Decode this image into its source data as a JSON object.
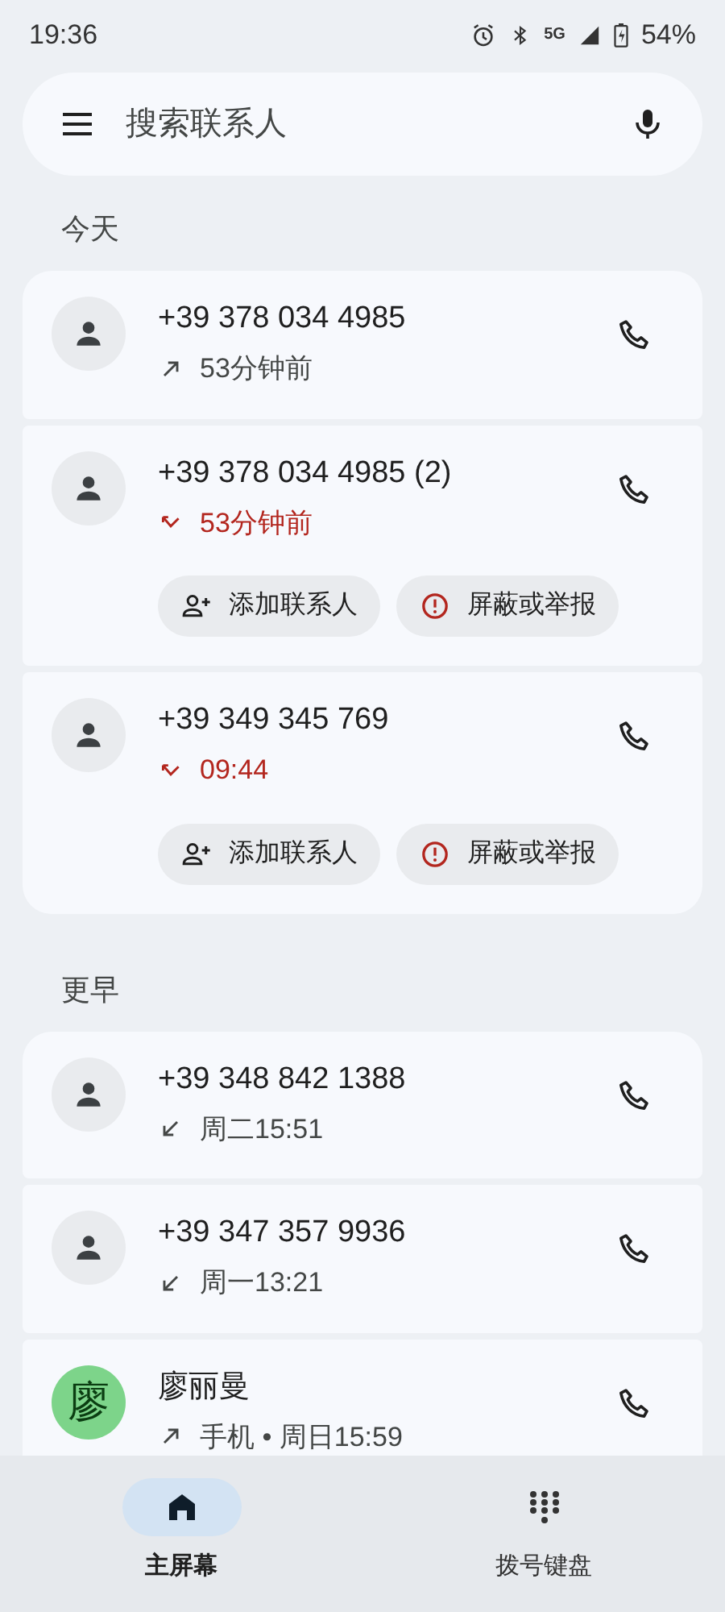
{
  "status_bar": {
    "time": "19:36",
    "network": "5G",
    "battery": "54%"
  },
  "search": {
    "placeholder": "搜索联系人"
  },
  "groups": [
    {
      "title": "今天",
      "calls": [
        {
          "number": "+39 378 034 4985",
          "kind": "outgoing",
          "detail": "53分钟前",
          "missed": false,
          "avatar": {
            "kind": "generic"
          }
        },
        {
          "number": "+39 378 034 4985 (2)",
          "kind": "missed",
          "detail": "53分钟前",
          "missed": true,
          "avatar": {
            "kind": "generic"
          },
          "actions": [
            {
              "kind": "add",
              "label": "添加联系人"
            },
            {
              "kind": "block",
              "label": "屏蔽或举报"
            }
          ]
        },
        {
          "number": "+39 349 345 769",
          "kind": "missed",
          "detail": "09:44",
          "missed": true,
          "avatar": {
            "kind": "generic"
          },
          "actions": [
            {
              "kind": "add",
              "label": "添加联系人"
            },
            {
              "kind": "block",
              "label": "屏蔽或举报"
            }
          ]
        }
      ]
    },
    {
      "title": "更早",
      "calls": [
        {
          "number": "+39 348 842 1388",
          "kind": "incoming",
          "detail": "周二15:51",
          "missed": false,
          "avatar": {
            "kind": "generic"
          }
        },
        {
          "number": "+39 347 357 9936",
          "kind": "incoming",
          "detail": "周一13:21",
          "missed": false,
          "avatar": {
            "kind": "generic"
          }
        },
        {
          "number": "廖丽曼",
          "kind": "outgoing",
          "detail": "手机 • 周日15:59",
          "missed": false,
          "avatar": {
            "kind": "letter",
            "letter": "廖",
            "color": "#7dd48a"
          }
        }
      ]
    }
  ],
  "nav": [
    {
      "kind": "home",
      "label": "主屏幕",
      "selected": true
    },
    {
      "kind": "dialpad",
      "label": "拨号键盘",
      "selected": false
    }
  ]
}
